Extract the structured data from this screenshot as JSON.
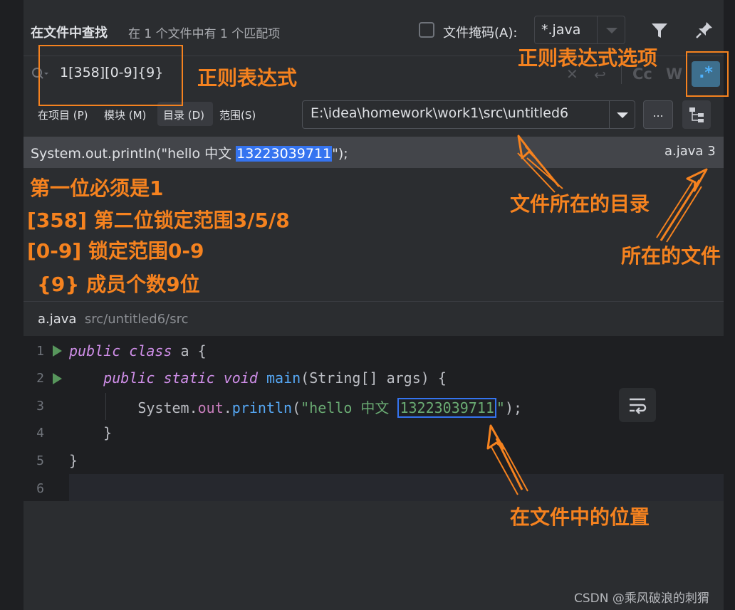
{
  "header": {
    "title": "在文件中查找",
    "count": "在 1 个文件中有 1 个匹配项",
    "file_mask_label": "文件掩码(A):",
    "file_mask_value": "*.java"
  },
  "search": {
    "query": "1[358][0-9]{9}",
    "match_case": "Cc",
    "words": "W",
    "regex": ".*"
  },
  "scope": {
    "project": "在项目 (P)",
    "module": "模块 (M)",
    "directory": "目录 (D)",
    "range": "范围(S)",
    "selected": "目录 (D)",
    "directory_path": "E:\\idea\\homework\\work1\\src\\untitled6",
    "browse": "..."
  },
  "result": {
    "line_prefix": "System.out.println(\"hello 中文 ",
    "match": "13223039711",
    "line_suffix": "\");",
    "file": "a.java 3"
  },
  "preview": {
    "file_name": "a.java",
    "file_path": "src/untitled6/src",
    "line_numbers": [
      "1",
      "2",
      "3",
      "4",
      "5",
      "6"
    ],
    "current_line": 6
  },
  "code": {
    "l1_kw1": "public",
    "l1_kw2": "class",
    "l1_rest": " a {",
    "l2_kw1": "public",
    "l2_kw2": "static",
    "l2_kw3": "void",
    "l2_fn": "main",
    "l2_rest": "(String[] args) {",
    "l3_sys": "System.",
    "l3_out": "out",
    "l3_dot": ".",
    "l3_fn": "println",
    "l3_open": "(",
    "l3_str": "\"hello 中文 ",
    "l3_num": "13223039711",
    "l3_strend": "\"",
    "l3_close": ");",
    "l4": "}",
    "l5": "}"
  },
  "annotations": {
    "regex": "正则表达式",
    "regex_option": "正则表达式选项",
    "file_dir": "文件所在的目录",
    "file": "所在的文件",
    "rule1": "第一位必须是1",
    "rule2": "[358] 第二位锁定范围3/5/8",
    "rule3": "[0-9] 锁定范围0-9",
    "rule4": "{9} 成员个数9位",
    "position": "在文件中的位置"
  },
  "watermark": "CSDN @乘风破浪的刺猬",
  "colors": {
    "accent_orange": "#f5821f",
    "match_highlight": "#3574f0",
    "panel_bg": "#2b2d30",
    "editor_bg": "#1e1f22"
  },
  "icons": [
    "filter-icon",
    "pin-icon",
    "search-icon",
    "clear-icon",
    "enter-icon",
    "tree-icon",
    "soft-wrap-icon",
    "run-icon"
  ]
}
